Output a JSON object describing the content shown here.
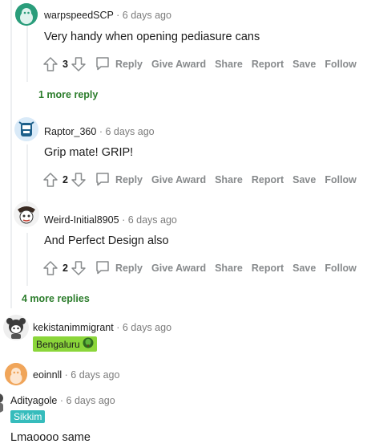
{
  "comments": [
    {
      "author": "warpspeedSCP",
      "time": "6 days ago",
      "body": "Very handy when opening pediasure cans",
      "score": "3"
    },
    {
      "author": "Raptor_360",
      "time": "6 days ago",
      "body": "Grip mate! GRIP!",
      "score": "2"
    },
    {
      "author": "Weird-Initial8905",
      "time": "6 days ago",
      "body": "And Perfect Design also",
      "score": "2"
    },
    {
      "author": "kekistanimmigrant",
      "time": "6 days ago",
      "flair": "Bengaluru"
    },
    {
      "author": "eoinnll",
      "time": "6 days ago"
    },
    {
      "author": "Adityagole",
      "time": "6 days ago",
      "flair": "Sikkim",
      "body": "Lmaoooo same"
    }
  ],
  "separator": "·",
  "actions": {
    "reply": "Reply",
    "give_award": "Give Award",
    "share": "Share",
    "report": "Report",
    "save": "Save",
    "follow": "Follow"
  },
  "more_replies_1": "1 more reply",
  "more_replies_4": "4 more replies",
  "colors": {
    "more_link": "#2c7d2c",
    "bengaluru_flair": "#8bd63a",
    "sikkim_flair": "#36bcbc",
    "action_text": "#878a8c"
  },
  "icons": [
    "upvote-icon",
    "downvote-icon",
    "reply-bubble-icon",
    "tree-icon"
  ]
}
